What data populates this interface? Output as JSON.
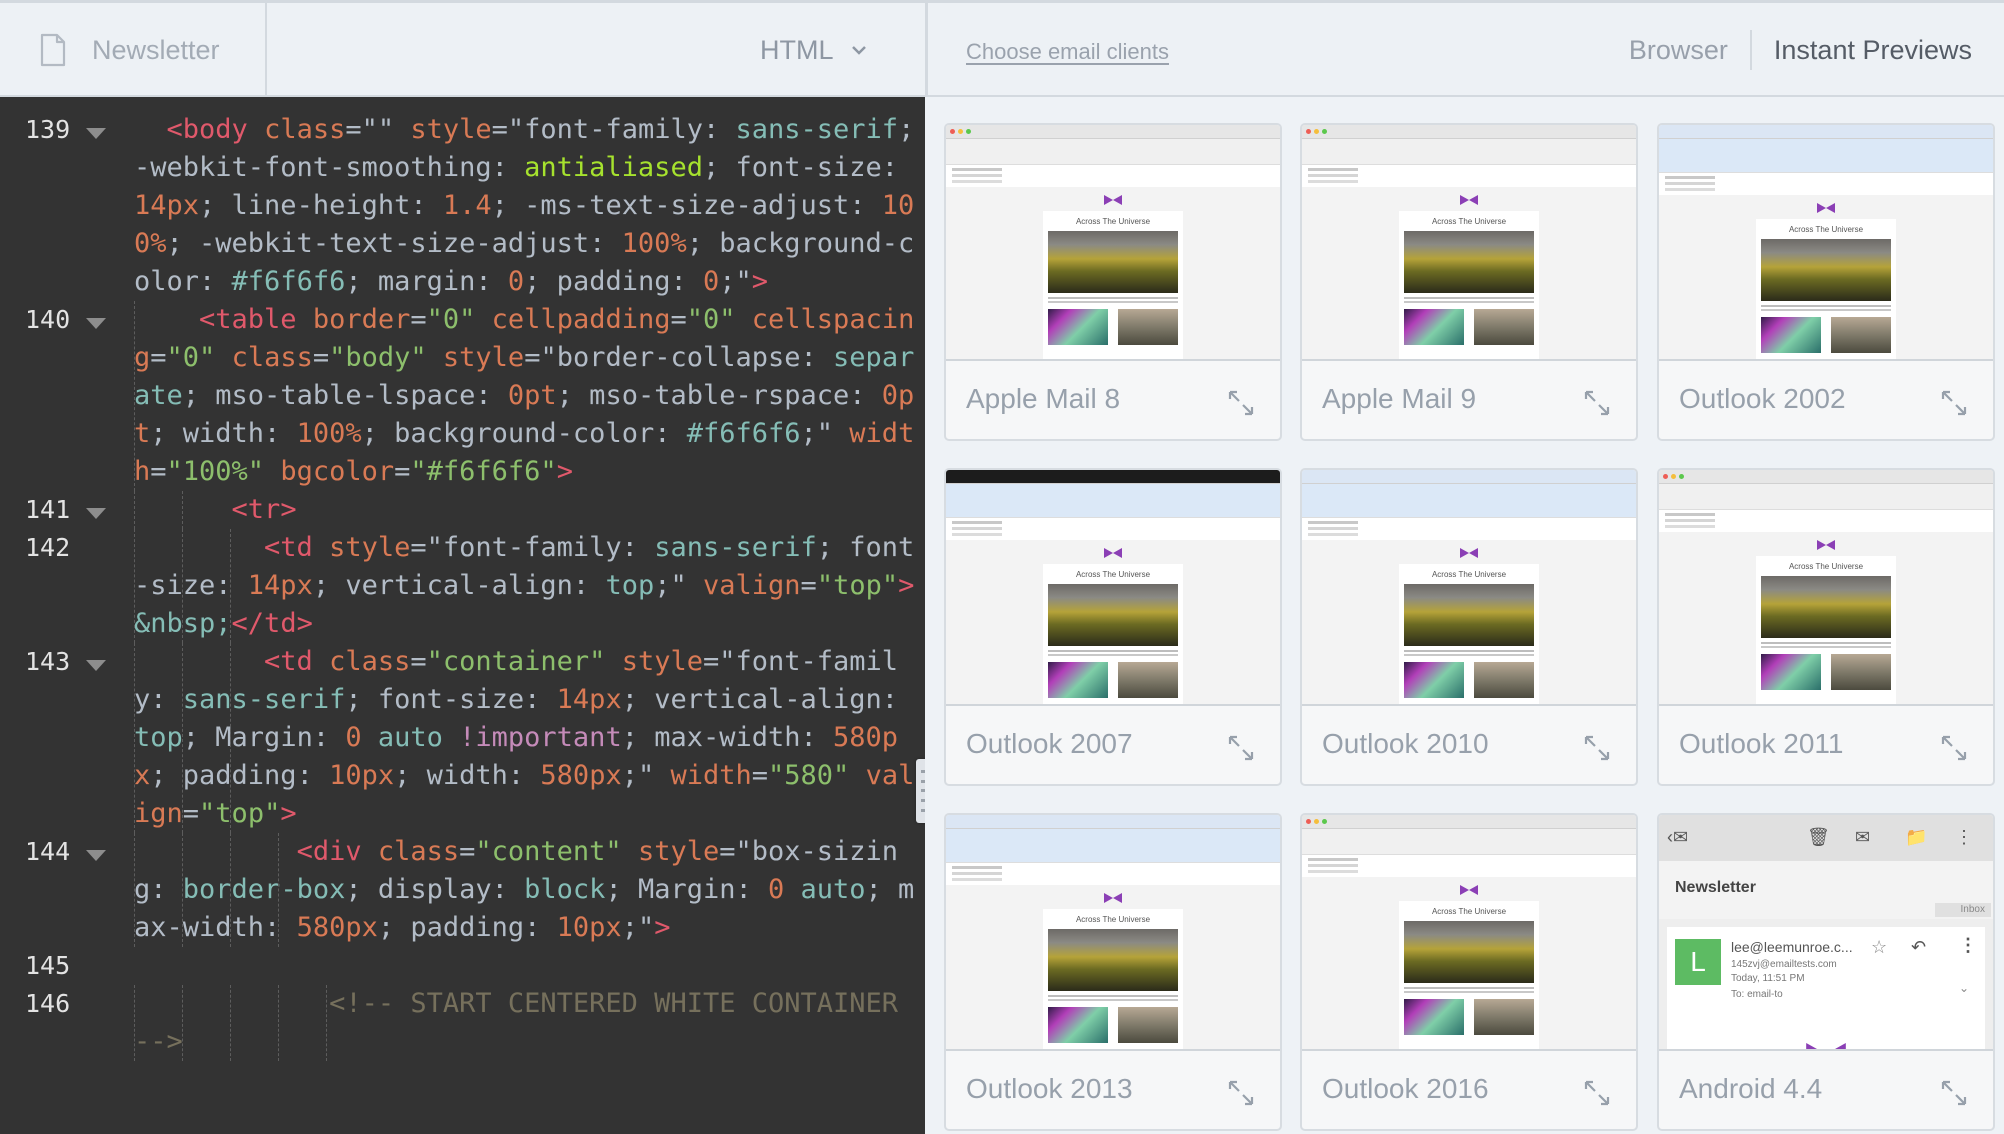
{
  "topbar": {
    "file_name": "Newsletter",
    "file_icon": "document-icon",
    "mode_label": "HTML",
    "mode_icon": "chevron-down-icon",
    "choose_clients_link": "Choose email clients",
    "view_browser": "Browser",
    "view_instant": "Instant Previews",
    "active_view": "Instant Previews"
  },
  "editor": {
    "lines": [
      {
        "number": "139",
        "fold": true,
        "indent": 1,
        "segments": [
          {
            "c": "t-tag",
            "t": "<body "
          },
          {
            "c": "t-attr",
            "t": "class"
          },
          {
            "c": "t-plain",
            "t": "=\"\" "
          },
          {
            "c": "t-attr",
            "t": "style"
          },
          {
            "c": "t-plain",
            "t": "=\"font-family: "
          },
          {
            "c": "t-kw",
            "t": "sans-serif"
          },
          {
            "c": "t-plain",
            "t": "; -webkit-font-smoothing: "
          },
          {
            "c": "t-lime",
            "t": "antialiased"
          },
          {
            "c": "t-plain",
            "t": "; font-size: "
          },
          {
            "c": "t-num",
            "t": "14px"
          },
          {
            "c": "t-plain",
            "t": "; line-height: "
          },
          {
            "c": "t-num",
            "t": "1.4"
          },
          {
            "c": "t-plain",
            "t": "; -ms-text-size-adjust: "
          },
          {
            "c": "t-num",
            "t": "100%"
          },
          {
            "c": "t-plain",
            "t": "; -webkit-text-size-adjust: "
          },
          {
            "c": "t-num",
            "t": "100%"
          },
          {
            "c": "t-plain",
            "t": "; background-color: "
          },
          {
            "c": "t-kw",
            "t": "#f6f6f6"
          },
          {
            "c": "t-plain",
            "t": "; margin: "
          },
          {
            "c": "t-num",
            "t": "0"
          },
          {
            "c": "t-plain",
            "t": "; padding: "
          },
          {
            "c": "t-num",
            "t": "0"
          },
          {
            "c": "t-plain",
            "t": ";\""
          },
          {
            "c": "t-tag",
            "t": ">"
          }
        ]
      },
      {
        "number": "140",
        "fold": true,
        "indent": 2,
        "segments": [
          {
            "c": "t-tag",
            "t": "<table "
          },
          {
            "c": "t-attr",
            "t": "border"
          },
          {
            "c": "t-plain",
            "t": "="
          },
          {
            "c": "t-str",
            "t": "\"0\" "
          },
          {
            "c": "t-attr",
            "t": "cellpadding"
          },
          {
            "c": "t-plain",
            "t": "="
          },
          {
            "c": "t-str",
            "t": "\"0\" "
          },
          {
            "c": "t-attr",
            "t": "cellspacing"
          },
          {
            "c": "t-plain",
            "t": "="
          },
          {
            "c": "t-str",
            "t": "\"0\" "
          },
          {
            "c": "t-attr",
            "t": "class"
          },
          {
            "c": "t-plain",
            "t": "="
          },
          {
            "c": "t-str",
            "t": "\"body\" "
          },
          {
            "c": "t-attr",
            "t": "style"
          },
          {
            "c": "t-plain",
            "t": "=\"border-collapse: "
          },
          {
            "c": "t-kw",
            "t": "separate"
          },
          {
            "c": "t-plain",
            "t": "; mso-table-lspace: "
          },
          {
            "c": "t-num",
            "t": "0pt"
          },
          {
            "c": "t-plain",
            "t": "; mso-table-rspace: "
          },
          {
            "c": "t-num",
            "t": "0pt"
          },
          {
            "c": "t-plain",
            "t": "; width: "
          },
          {
            "c": "t-num",
            "t": "100%"
          },
          {
            "c": "t-plain",
            "t": "; background-color: "
          },
          {
            "c": "t-kw",
            "t": "#f6f6f6"
          },
          {
            "c": "t-plain",
            "t": ";\" "
          },
          {
            "c": "t-attr",
            "t": "width"
          },
          {
            "c": "t-plain",
            "t": "="
          },
          {
            "c": "t-str",
            "t": "\"100%\" "
          },
          {
            "c": "t-attr",
            "t": "bgcolor"
          },
          {
            "c": "t-plain",
            "t": "="
          },
          {
            "c": "t-str",
            "t": "\"#f6f6f6\""
          },
          {
            "c": "t-tag",
            "t": ">"
          }
        ]
      },
      {
        "number": "141",
        "fold": true,
        "indent": 3,
        "segments": [
          {
            "c": "t-tag",
            "t": "<tr>"
          }
        ]
      },
      {
        "number": "142",
        "fold": false,
        "indent": 4,
        "segments": [
          {
            "c": "t-tag",
            "t": "<td "
          },
          {
            "c": "t-attr",
            "t": "style"
          },
          {
            "c": "t-plain",
            "t": "=\"font-family: "
          },
          {
            "c": "t-kw",
            "t": "sans-serif"
          },
          {
            "c": "t-plain",
            "t": "; font-size: "
          },
          {
            "c": "t-num",
            "t": "14px"
          },
          {
            "c": "t-plain",
            "t": "; vertical-align: "
          },
          {
            "c": "t-kw",
            "t": "top"
          },
          {
            "c": "t-plain",
            "t": ";\" "
          },
          {
            "c": "t-attr",
            "t": "valign"
          },
          {
            "c": "t-plain",
            "t": "="
          },
          {
            "c": "t-str",
            "t": "\"top\""
          },
          {
            "c": "t-tag",
            "t": ">"
          },
          {
            "c": "t-kw",
            "t": "&nbsp;"
          },
          {
            "c": "t-tag",
            "t": "</td>"
          }
        ]
      },
      {
        "number": "143",
        "fold": true,
        "indent": 4,
        "segments": [
          {
            "c": "t-tag",
            "t": "<td "
          },
          {
            "c": "t-attr",
            "t": "class"
          },
          {
            "c": "t-plain",
            "t": "="
          },
          {
            "c": "t-str",
            "t": "\"container\" "
          },
          {
            "c": "t-attr",
            "t": "style"
          },
          {
            "c": "t-plain",
            "t": "=\"font-family: "
          },
          {
            "c": "t-kw",
            "t": "sans-serif"
          },
          {
            "c": "t-plain",
            "t": "; font-size: "
          },
          {
            "c": "t-num",
            "t": "14px"
          },
          {
            "c": "t-plain",
            "t": "; vertical-align: "
          },
          {
            "c": "t-kw",
            "t": "top"
          },
          {
            "c": "t-plain",
            "t": "; Margin: "
          },
          {
            "c": "t-num",
            "t": "0 "
          },
          {
            "c": "t-kw",
            "t": "auto "
          },
          {
            "c": "t-imp",
            "t": "!important"
          },
          {
            "c": "t-plain",
            "t": "; max-width: "
          },
          {
            "c": "t-num",
            "t": "580px"
          },
          {
            "c": "t-plain",
            "t": "; padding: "
          },
          {
            "c": "t-num",
            "t": "10px"
          },
          {
            "c": "t-plain",
            "t": "; width: "
          },
          {
            "c": "t-num",
            "t": "580px"
          },
          {
            "c": "t-plain",
            "t": ";\" "
          },
          {
            "c": "t-attr",
            "t": "width"
          },
          {
            "c": "t-plain",
            "t": "="
          },
          {
            "c": "t-str",
            "t": "\"580\" "
          },
          {
            "c": "t-attr",
            "t": "valign"
          },
          {
            "c": "t-plain",
            "t": "="
          },
          {
            "c": "t-str",
            "t": "\"top\""
          },
          {
            "c": "t-tag",
            "t": ">"
          }
        ]
      },
      {
        "number": "144",
        "fold": true,
        "indent": 5,
        "segments": [
          {
            "c": "t-tag",
            "t": "<div "
          },
          {
            "c": "t-attr",
            "t": "class"
          },
          {
            "c": "t-plain",
            "t": "="
          },
          {
            "c": "t-str",
            "t": "\"content\" "
          },
          {
            "c": "t-attr",
            "t": "style"
          },
          {
            "c": "t-plain",
            "t": "=\"box-sizing: "
          },
          {
            "c": "t-kw",
            "t": "border-box"
          },
          {
            "c": "t-plain",
            "t": "; display: "
          },
          {
            "c": "t-kw",
            "t": "block"
          },
          {
            "c": "t-plain",
            "t": "; Margin: "
          },
          {
            "c": "t-num",
            "t": "0 "
          },
          {
            "c": "t-kw",
            "t": "auto"
          },
          {
            "c": "t-plain",
            "t": "; max-width: "
          },
          {
            "c": "t-num",
            "t": "580px"
          },
          {
            "c": "t-plain",
            "t": "; padding: "
          },
          {
            "c": "t-num",
            "t": "10px"
          },
          {
            "c": "t-plain",
            "t": ";\""
          },
          {
            "c": "t-tag",
            "t": ">"
          }
        ]
      },
      {
        "number": "145",
        "fold": false,
        "indent": 0,
        "segments": [
          {
            "c": "t-plain",
            "t": " "
          }
        ]
      },
      {
        "number": "146",
        "fold": false,
        "indent": 6,
        "segments": [
          {
            "c": "t-cm",
            "t": "<!-- START CENTERED WHITE CONTAINER -->"
          }
        ]
      }
    ]
  },
  "previews": {
    "email_title": "Across The Universe",
    "cards": [
      {
        "label": "Apple Mail 8",
        "style": "mac"
      },
      {
        "label": "Apple Mail 9",
        "style": "mac"
      },
      {
        "label": "Outlook 2002",
        "style": "win"
      },
      {
        "label": "Outlook 2007",
        "style": "win2007"
      },
      {
        "label": "Outlook 2010",
        "style": "win"
      },
      {
        "label": "Outlook 2011",
        "style": "mac"
      },
      {
        "label": "Outlook 2013",
        "style": "win"
      },
      {
        "label": "Outlook 2016",
        "style": "mac"
      },
      {
        "label": "Android 4.4",
        "style": "android"
      }
    ],
    "android": {
      "subject": "Newsletter",
      "folder": "Inbox",
      "avatar_letter": "L",
      "from": "lee@leemunroe.c...",
      "to_address": "145zvj@emailtests.com",
      "time": "Today, 11:51 PM",
      "to_line": "To: email-to"
    },
    "expand_icon": "expand-icon"
  }
}
